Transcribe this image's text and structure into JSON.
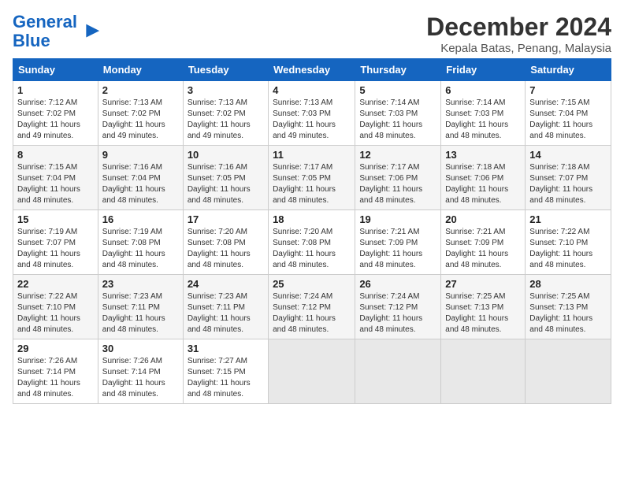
{
  "logo": {
    "line1": "General",
    "line2": "Blue"
  },
  "title": "December 2024",
  "location": "Kepala Batas, Penang, Malaysia",
  "weekdays": [
    "Sunday",
    "Monday",
    "Tuesday",
    "Wednesday",
    "Thursday",
    "Friday",
    "Saturday"
  ],
  "weeks": [
    [
      {
        "day": "1",
        "info": "Sunrise: 7:12 AM\nSunset: 7:02 PM\nDaylight: 11 hours\nand 49 minutes."
      },
      {
        "day": "2",
        "info": "Sunrise: 7:13 AM\nSunset: 7:02 PM\nDaylight: 11 hours\nand 49 minutes."
      },
      {
        "day": "3",
        "info": "Sunrise: 7:13 AM\nSunset: 7:02 PM\nDaylight: 11 hours\nand 49 minutes."
      },
      {
        "day": "4",
        "info": "Sunrise: 7:13 AM\nSunset: 7:03 PM\nDaylight: 11 hours\nand 49 minutes."
      },
      {
        "day": "5",
        "info": "Sunrise: 7:14 AM\nSunset: 7:03 PM\nDaylight: 11 hours\nand 48 minutes."
      },
      {
        "day": "6",
        "info": "Sunrise: 7:14 AM\nSunset: 7:03 PM\nDaylight: 11 hours\nand 48 minutes."
      },
      {
        "day": "7",
        "info": "Sunrise: 7:15 AM\nSunset: 7:04 PM\nDaylight: 11 hours\nand 48 minutes."
      }
    ],
    [
      {
        "day": "8",
        "info": "Sunrise: 7:15 AM\nSunset: 7:04 PM\nDaylight: 11 hours\nand 48 minutes."
      },
      {
        "day": "9",
        "info": "Sunrise: 7:16 AM\nSunset: 7:04 PM\nDaylight: 11 hours\nand 48 minutes."
      },
      {
        "day": "10",
        "info": "Sunrise: 7:16 AM\nSunset: 7:05 PM\nDaylight: 11 hours\nand 48 minutes."
      },
      {
        "day": "11",
        "info": "Sunrise: 7:17 AM\nSunset: 7:05 PM\nDaylight: 11 hours\nand 48 minutes."
      },
      {
        "day": "12",
        "info": "Sunrise: 7:17 AM\nSunset: 7:06 PM\nDaylight: 11 hours\nand 48 minutes."
      },
      {
        "day": "13",
        "info": "Sunrise: 7:18 AM\nSunset: 7:06 PM\nDaylight: 11 hours\nand 48 minutes."
      },
      {
        "day": "14",
        "info": "Sunrise: 7:18 AM\nSunset: 7:07 PM\nDaylight: 11 hours\nand 48 minutes."
      }
    ],
    [
      {
        "day": "15",
        "info": "Sunrise: 7:19 AM\nSunset: 7:07 PM\nDaylight: 11 hours\nand 48 minutes."
      },
      {
        "day": "16",
        "info": "Sunrise: 7:19 AM\nSunset: 7:08 PM\nDaylight: 11 hours\nand 48 minutes."
      },
      {
        "day": "17",
        "info": "Sunrise: 7:20 AM\nSunset: 7:08 PM\nDaylight: 11 hours\nand 48 minutes."
      },
      {
        "day": "18",
        "info": "Sunrise: 7:20 AM\nSunset: 7:08 PM\nDaylight: 11 hours\nand 48 minutes."
      },
      {
        "day": "19",
        "info": "Sunrise: 7:21 AM\nSunset: 7:09 PM\nDaylight: 11 hours\nand 48 minutes."
      },
      {
        "day": "20",
        "info": "Sunrise: 7:21 AM\nSunset: 7:09 PM\nDaylight: 11 hours\nand 48 minutes."
      },
      {
        "day": "21",
        "info": "Sunrise: 7:22 AM\nSunset: 7:10 PM\nDaylight: 11 hours\nand 48 minutes."
      }
    ],
    [
      {
        "day": "22",
        "info": "Sunrise: 7:22 AM\nSunset: 7:10 PM\nDaylight: 11 hours\nand 48 minutes."
      },
      {
        "day": "23",
        "info": "Sunrise: 7:23 AM\nSunset: 7:11 PM\nDaylight: 11 hours\nand 48 minutes."
      },
      {
        "day": "24",
        "info": "Sunrise: 7:23 AM\nSunset: 7:11 PM\nDaylight: 11 hours\nand 48 minutes."
      },
      {
        "day": "25",
        "info": "Sunrise: 7:24 AM\nSunset: 7:12 PM\nDaylight: 11 hours\nand 48 minutes."
      },
      {
        "day": "26",
        "info": "Sunrise: 7:24 AM\nSunset: 7:12 PM\nDaylight: 11 hours\nand 48 minutes."
      },
      {
        "day": "27",
        "info": "Sunrise: 7:25 AM\nSunset: 7:13 PM\nDaylight: 11 hours\nand 48 minutes."
      },
      {
        "day": "28",
        "info": "Sunrise: 7:25 AM\nSunset: 7:13 PM\nDaylight: 11 hours\nand 48 minutes."
      }
    ],
    [
      {
        "day": "29",
        "info": "Sunrise: 7:26 AM\nSunset: 7:14 PM\nDaylight: 11 hours\nand 48 minutes."
      },
      {
        "day": "30",
        "info": "Sunrise: 7:26 AM\nSunset: 7:14 PM\nDaylight: 11 hours\nand 48 minutes."
      },
      {
        "day": "31",
        "info": "Sunrise: 7:27 AM\nSunset: 7:15 PM\nDaylight: 11 hours\nand 48 minutes."
      },
      {
        "day": "",
        "info": ""
      },
      {
        "day": "",
        "info": ""
      },
      {
        "day": "",
        "info": ""
      },
      {
        "day": "",
        "info": ""
      }
    ]
  ]
}
